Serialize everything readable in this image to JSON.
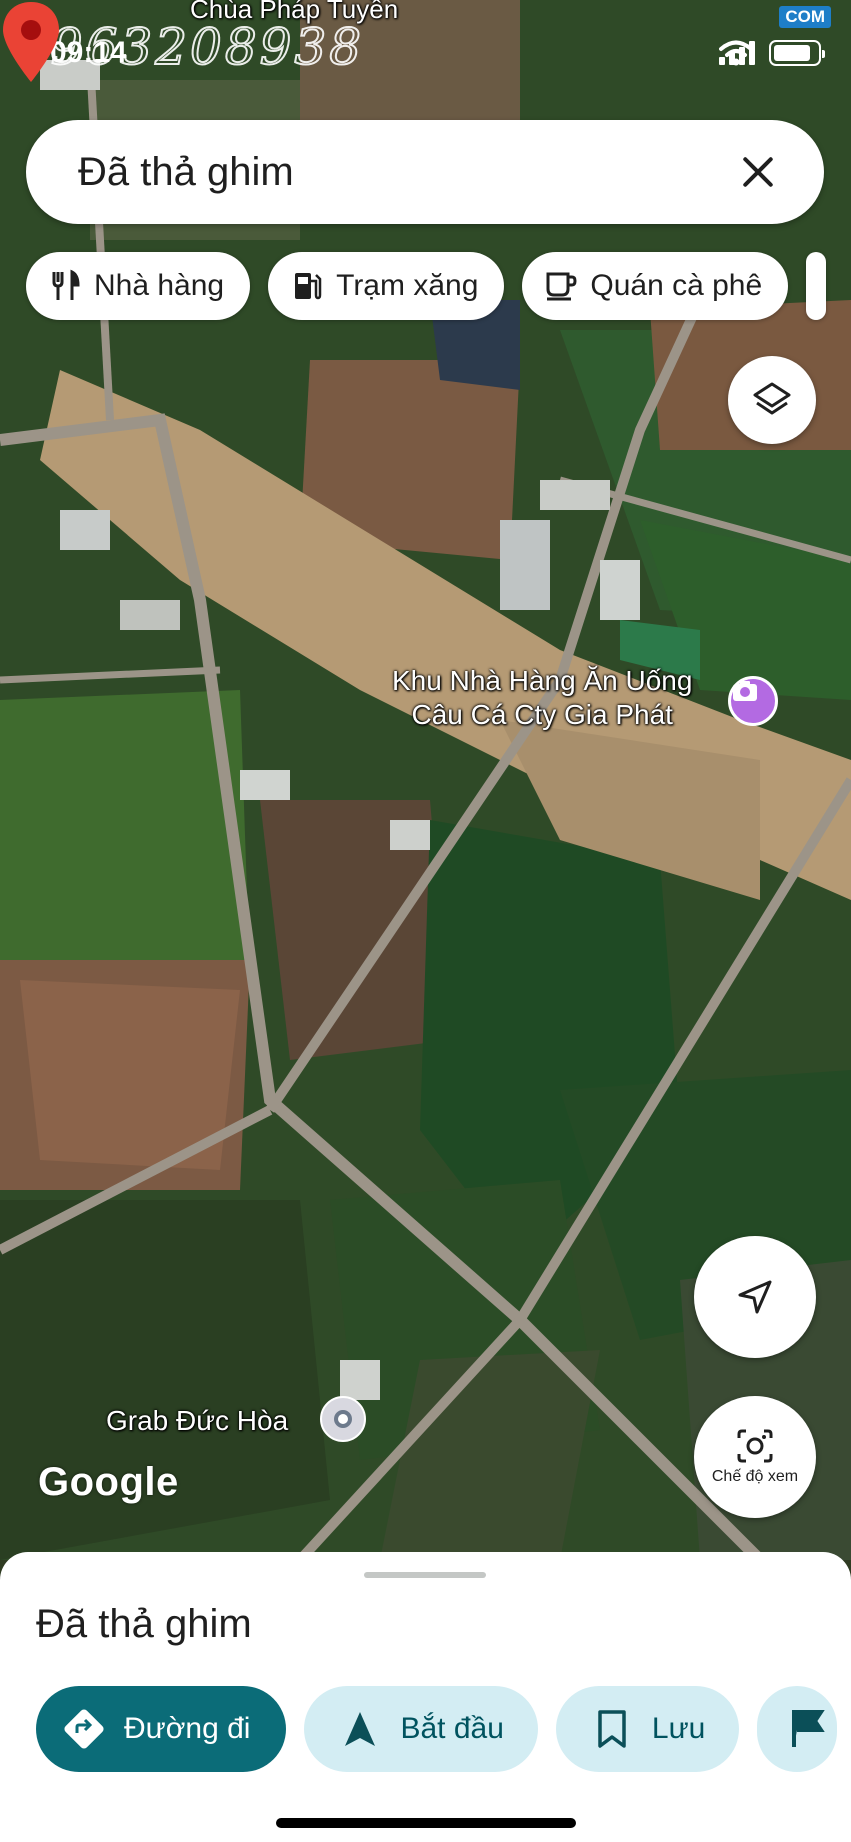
{
  "status_bar": {
    "time": "09:14",
    "watermark_phone": "0963208938",
    "site_logo": "COM",
    "battery_level_percent": 85,
    "signal_bars": 4,
    "wifi_icon": "wifi-icon"
  },
  "search": {
    "query": "Đã thả ghim",
    "close_icon": "close-icon"
  },
  "chips": [
    {
      "label": "Nhà hàng",
      "icon": "restaurant-icon"
    },
    {
      "label": "Trạm xăng",
      "icon": "gas-station-icon"
    },
    {
      "label": "Quán cà phê",
      "icon": "coffee-icon"
    }
  ],
  "map": {
    "type": "satellite",
    "labels": {
      "top_poi": "Chùa Pháp Tuyền",
      "restaurant_poi": "Khu Nhà Hàng Ăn Uống\nCâu Cá Cty Gia Phát",
      "grab_poi": "Grab Đức Hòa"
    },
    "google_logo": "Google",
    "controls": {
      "layers_icon": "layers-icon",
      "locate_icon": "navigation-arrow-icon",
      "lens_label": "Chế độ xem",
      "lens_icon": "camera-lens-icon"
    },
    "pin_color": "#ea4335",
    "restaurant_badge_color": "#b36ae2"
  },
  "sheet": {
    "title": "Đã thả ghim",
    "actions": [
      {
        "label": "Đường đi",
        "icon": "directions-icon",
        "primary": true
      },
      {
        "label": "Bắt đầu",
        "icon": "navigation-icon",
        "primary": false
      },
      {
        "label": "Lưu",
        "icon": "bookmark-icon",
        "primary": false
      },
      {
        "label": "",
        "icon": "flag-icon",
        "primary": false
      }
    ],
    "accent_color": "#0b6c78",
    "secondary_bg": "#d3edf3"
  }
}
